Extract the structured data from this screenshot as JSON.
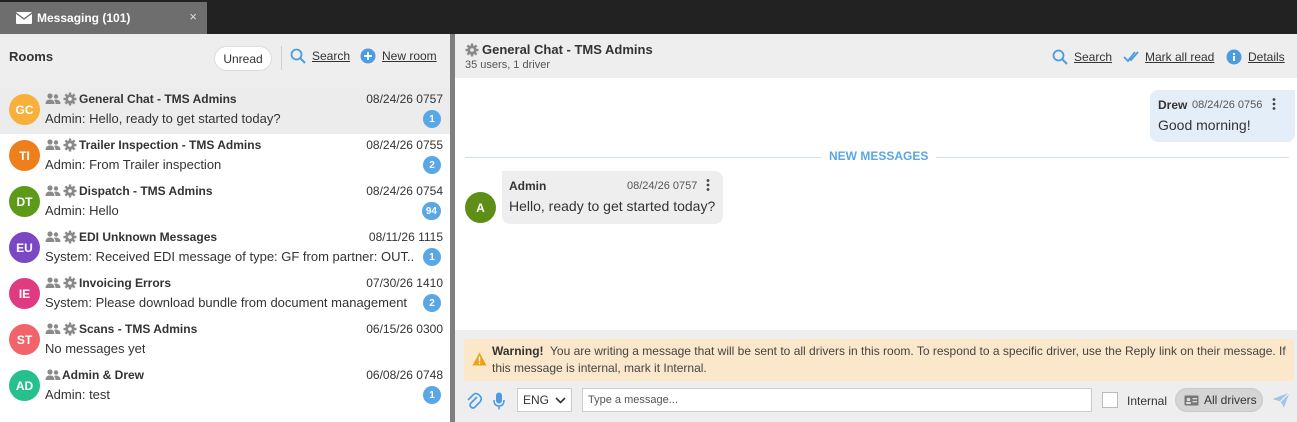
{
  "tab": {
    "title": "Messaging (101)",
    "close": "×",
    "icon": "envelope-icon"
  },
  "left": {
    "title": "Rooms",
    "unread_label": "Unread",
    "search_label": "Search",
    "new_room_label": "New room"
  },
  "rooms": [
    {
      "initials": "GC",
      "color": "#f6b03b",
      "name": "General Chat - TMS Admins",
      "time": "08/24/26 0757",
      "preview": "Admin: Hello, ready to get started today?",
      "badge": "1",
      "gear": true,
      "active": true
    },
    {
      "initials": "TI",
      "color": "#ef7e1d",
      "name": "Trailer Inspection - TMS Admins",
      "time": "08/24/26 0755",
      "preview": "Admin: From Trailer inspection",
      "badge": "2",
      "gear": true
    },
    {
      "initials": "DT",
      "color": "#5d9a19",
      "name": "Dispatch - TMS Admins",
      "time": "08/24/26 0754",
      "preview": "Admin: Hello",
      "badge": "94",
      "gear": true
    },
    {
      "initials": "EU",
      "color": "#7b48c4",
      "name": "EDI Unknown Messages",
      "time": "08/11/26 1115",
      "preview": "System: Received EDI message of type: GF from partner: OUT...",
      "badge": "1",
      "gear": true
    },
    {
      "initials": "IE",
      "color": "#e03a82",
      "name": "Invoicing Errors",
      "time": "07/30/26 1410",
      "preview": "System: Please download bundle from document management",
      "badge": "2",
      "gear": true
    },
    {
      "initials": "ST",
      "color": "#f0646a",
      "name": "Scans - TMS Admins",
      "time": "06/15/26 0300",
      "preview": "No messages yet",
      "badge": "",
      "gear": true
    },
    {
      "initials": "AD",
      "color": "#26c08d",
      "name": "Admin & Drew",
      "time": "06/08/26 0748",
      "preview": "Admin: test",
      "badge": "1",
      "gear": false
    }
  ],
  "chat": {
    "title": "General Chat - TMS Admins",
    "subtitle": "35 users, 1 driver",
    "search_label": "Search",
    "mark_all_read_label": "Mark all read",
    "details_label": "Details",
    "new_messages_label": "NEW MESSAGES",
    "messages": [
      {
        "sender": "Drew",
        "time": "08/24/26 0756",
        "text": "Good morning!",
        "direction": "outgoing"
      },
      {
        "sender": "Admin",
        "avatar": "A",
        "time": "08/24/26 0757",
        "text": "Hello, ready to get started today?",
        "direction": "incoming"
      }
    ]
  },
  "compose": {
    "warning_title": "Warning!",
    "warning_text": "You are writing a message that will be sent to all drivers in this room. To respond to a specific driver, use the Reply link on their message. If this message is internal, mark it Internal.",
    "language": "ENG",
    "placeholder": "Type a message...",
    "internal_label": "Internal",
    "drivers_label": "All drivers"
  },
  "colors": {
    "accent": "#5aa7e6",
    "warning_bg": "#fbe7c9",
    "warning_icon": "#e8a317"
  }
}
